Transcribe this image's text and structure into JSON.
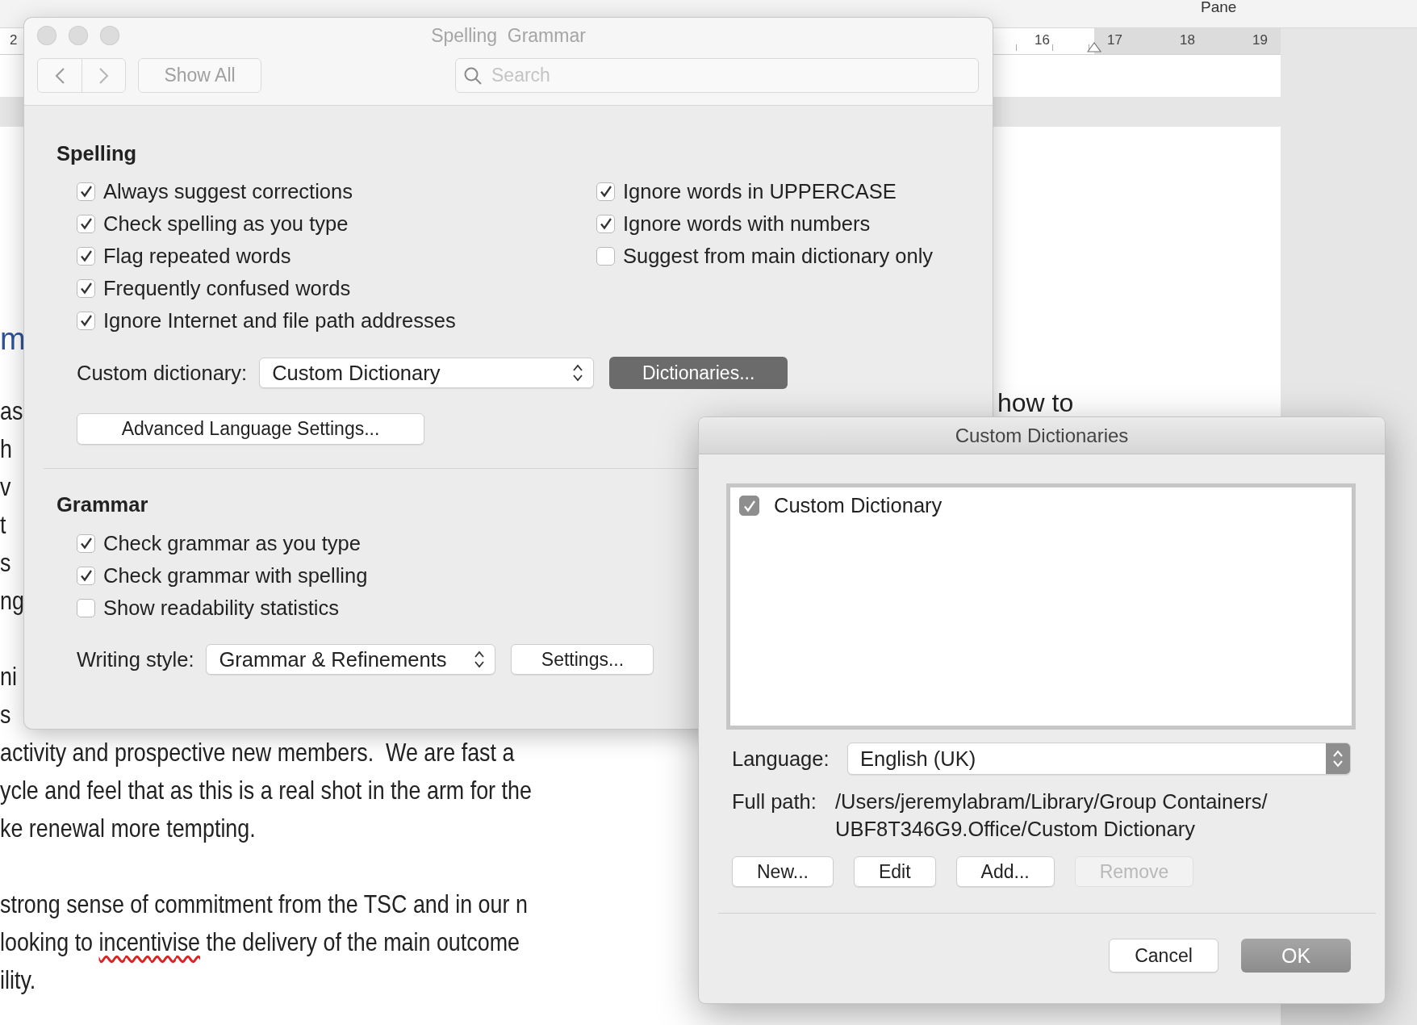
{
  "word": {
    "toolbar": {
      "pane_label": "Pane"
    },
    "ruler": {
      "left_number": "2",
      "numbers": [
        "16",
        "17",
        "18",
        "19"
      ]
    },
    "document": {
      "heading_fragment": "m",
      "side_fragment": "how to",
      "paragraphs": [
        {
          "lines": [
            {
              "segments": [
                {
                  "kind": "text",
                  "text": "as"
                }
              ]
            },
            {
              "segments": [
                {
                  "kind": "text",
                  "text": "h"
                }
              ]
            },
            {
              "segments": [
                {
                  "kind": "text",
                  "text": "v"
                }
              ]
            },
            {
              "segments": [
                {
                  "kind": "text",
                  "text": "t"
                }
              ]
            },
            {
              "segments": [
                {
                  "kind": "text",
                  "text": "s"
                }
              ]
            },
            {
              "segments": [
                {
                  "kind": "text",
                  "text": "ng"
                }
              ]
            }
          ]
        },
        {
          "lines": [
            {
              "segments": [
                {
                  "kind": "text",
                  "text": "ni"
                }
              ]
            },
            {
              "segments": [
                {
                  "kind": "text",
                  "text": "s"
                }
              ]
            },
            {
              "segments": [
                {
                  "kind": "text",
                  "text": "activity and prospective new members.  We are fast a"
                }
              ]
            },
            {
              "segments": [
                {
                  "kind": "text",
                  "text": "ycle and feel that as this is a real shot in the arm for the"
                }
              ]
            },
            {
              "segments": [
                {
                  "kind": "text",
                  "text": "ke renewal more tempting."
                }
              ]
            }
          ]
        },
        {
          "lines": [
            {
              "segments": [
                {
                  "kind": "text",
                  "text": "strong sense of commitment from the TSC and in our n"
                }
              ]
            },
            {
              "segments": [
                {
                  "kind": "text",
                  "text": "looking to "
                },
                {
                  "kind": "misspelled",
                  "text": "incentivise"
                },
                {
                  "kind": "text",
                  "text": " the delivery of the main outcome"
                }
              ]
            },
            {
              "segments": [
                {
                  "kind": "text",
                  "text": "ility."
                }
              ]
            }
          ]
        }
      ]
    }
  },
  "preferences": {
    "title": "Spelling  Grammar",
    "show_all": "Show All",
    "search": {
      "placeholder": "Search"
    },
    "spelling": {
      "heading": "Spelling",
      "left_options": [
        {
          "label": "Always suggest corrections",
          "checked": true
        },
        {
          "label": "Check spelling as you type",
          "checked": true
        },
        {
          "label": "Flag repeated words",
          "checked": true
        },
        {
          "label": "Frequently confused words",
          "checked": true
        },
        {
          "label": "Ignore Internet and file path addresses",
          "checked": true
        }
      ],
      "right_options": [
        {
          "label": "Ignore words in UPPERCASE",
          "checked": true
        },
        {
          "label": "Ignore words with numbers",
          "checked": true
        },
        {
          "label": "Suggest from main dictionary only",
          "checked": false
        }
      ],
      "custom_dictionary": {
        "label": "Custom dictionary:",
        "value": "Custom Dictionary"
      },
      "dictionaries_button": "Dictionaries...",
      "advanced_button": "Advanced Language Settings..."
    },
    "grammar": {
      "heading": "Grammar",
      "options": [
        {
          "label": "Check grammar as you type",
          "checked": true
        },
        {
          "label": "Check grammar with spelling",
          "checked": true
        },
        {
          "label": "Show readability statistics",
          "checked": false
        }
      ],
      "writing_style": {
        "label": "Writing style:",
        "value": "Grammar & Refinements"
      },
      "settings_button": "Settings..."
    }
  },
  "custom_dictionaries": {
    "title": "Custom Dictionaries",
    "dictionaries": [
      {
        "name": "Custom Dictionary",
        "checked": true
      }
    ],
    "language": {
      "label": "Language:",
      "value": "English (UK)"
    },
    "full_path": {
      "label": "Full path:",
      "value": "/Users/jeremylabram/Library/Group Containers/\nUBF8T346G9.Office/Custom Dictionary"
    },
    "buttons": [
      {
        "label": "New...",
        "disabled": false
      },
      {
        "label": "Edit",
        "disabled": false
      },
      {
        "label": "Add...",
        "disabled": false
      },
      {
        "label": "Remove",
        "disabled": true
      }
    ],
    "cancel": "Cancel",
    "ok": "OK"
  }
}
